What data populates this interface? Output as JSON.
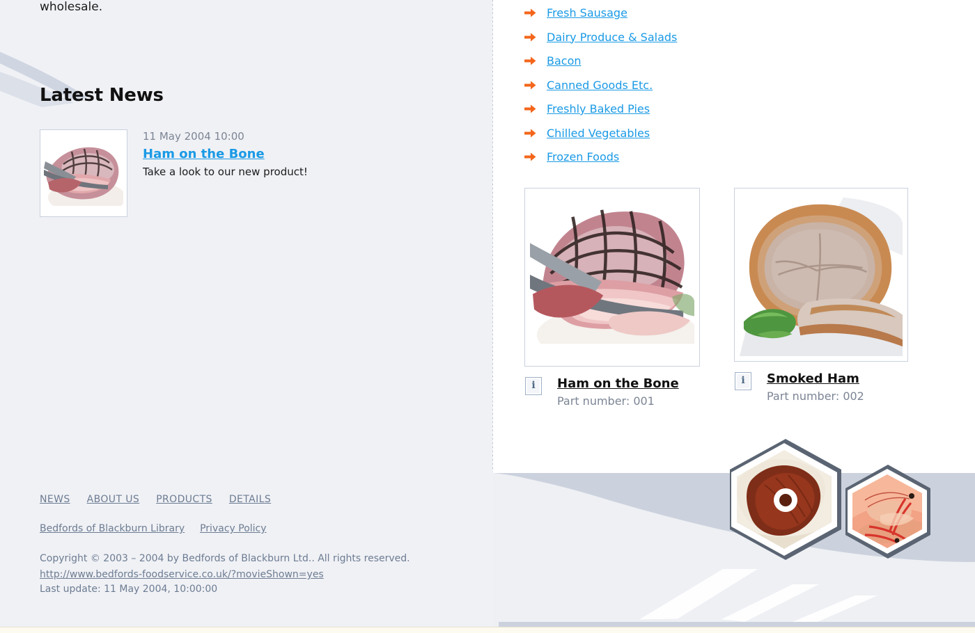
{
  "theme": {
    "page_bg": "#f0f1f5",
    "right_bg": "#ffffff",
    "link_blue": "#1a9ae5",
    "muted_text": "#7c8594",
    "footer_link": "#6c7c92",
    "arrow_orange": "#f4661b",
    "art_blue_gray": "#ccd2dd",
    "bottom_strip": "#fdfbf0"
  },
  "left": {
    "intro_text_tail": "wholesale.",
    "latest_news_heading": "Latest News",
    "news": {
      "date": "11 May 2004 10:00",
      "title": "Ham on the Bone",
      "description": "Take a look to our new product!",
      "thumbnail_alt": "sliced-ham-on-plate"
    }
  },
  "footer": {
    "nav": [
      {
        "label": "NEWS"
      },
      {
        "label": "ABOUT US"
      },
      {
        "label": "PRODUCTS"
      },
      {
        "label": "DETAILS"
      }
    ],
    "links": [
      {
        "label": "Bedfords of Blackburn Library"
      },
      {
        "label": "Privacy Policy"
      }
    ],
    "copyright": "Copyright © 2003 – 2004 by Bedfords of Blackburn Ltd.. All rights reserved.",
    "url": "http://www.bedfords-foodservice.co.uk/?movieShown=yes",
    "last_update": "Last update: 11 May 2004, 10:00:00"
  },
  "right": {
    "categories": [
      {
        "label": "Fresh Sausage"
      },
      {
        "label": "Dairy Produce & Salads"
      },
      {
        "label": "Bacon"
      },
      {
        "label": "Canned Goods Etc."
      },
      {
        "label": "Freshly Baked Pies"
      },
      {
        "label": "Chilled Vegetables"
      },
      {
        "label": "Frozen Foods"
      }
    ],
    "products": [
      {
        "name": "Ham on the Bone",
        "part_label": "Part number: 001",
        "info_glyph": "i",
        "image_alt": "carved-ham-with-knife"
      },
      {
        "name": "Smoked Ham",
        "part_label": "Part number: 002",
        "info_glyph": "i",
        "image_alt": "smoked-ham-roast-with-garnish"
      }
    ],
    "badges": [
      {
        "alt": "gammon-joint-hexagon-badge"
      },
      {
        "alt": "prawns-hexagon-badge"
      }
    ]
  }
}
